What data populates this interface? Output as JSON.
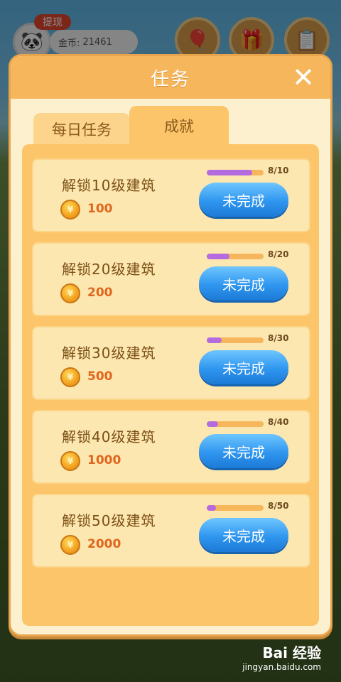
{
  "hud": {
    "withdraw_label": "提现",
    "coins_label": "金币:",
    "coins_value": "21461",
    "avatar_icon": "panda-avatar-icon",
    "buttons": [
      {
        "icon": "balloon-icon"
      },
      {
        "icon": "gift-box-icon"
      },
      {
        "icon": "clipboard-icon"
      }
    ]
  },
  "modal": {
    "title": "任务",
    "close_symbol": "✕",
    "tabs": [
      {
        "label": "每日任务",
        "active": false
      },
      {
        "label": "成就",
        "active": true
      }
    ],
    "achievements": [
      {
        "title": "解锁10级建筑",
        "reward": "100",
        "progress_text": "8/10",
        "progress": 0.8,
        "button": "未完成"
      },
      {
        "title": "解锁20级建筑",
        "reward": "200",
        "progress_text": "8/20",
        "progress": 0.4,
        "button": "未完成"
      },
      {
        "title": "解锁30级建筑",
        "reward": "500",
        "progress_text": "8/30",
        "progress": 0.267,
        "button": "未完成"
      },
      {
        "title": "解锁40级建筑",
        "reward": "1000",
        "progress_text": "8/40",
        "progress": 0.2,
        "button": "未完成"
      },
      {
        "title": "解锁50级建筑",
        "reward": "2000",
        "progress_text": "8/50",
        "progress": 0.16,
        "button": "未完成"
      }
    ]
  },
  "watermark": {
    "line1": "Bai 经验",
    "line2": "jingyan.baidu.com"
  },
  "colors": {
    "accent_orange": "#f6b75c",
    "button_blue": "#2f96ef",
    "progress_purple": "#b56be0"
  }
}
